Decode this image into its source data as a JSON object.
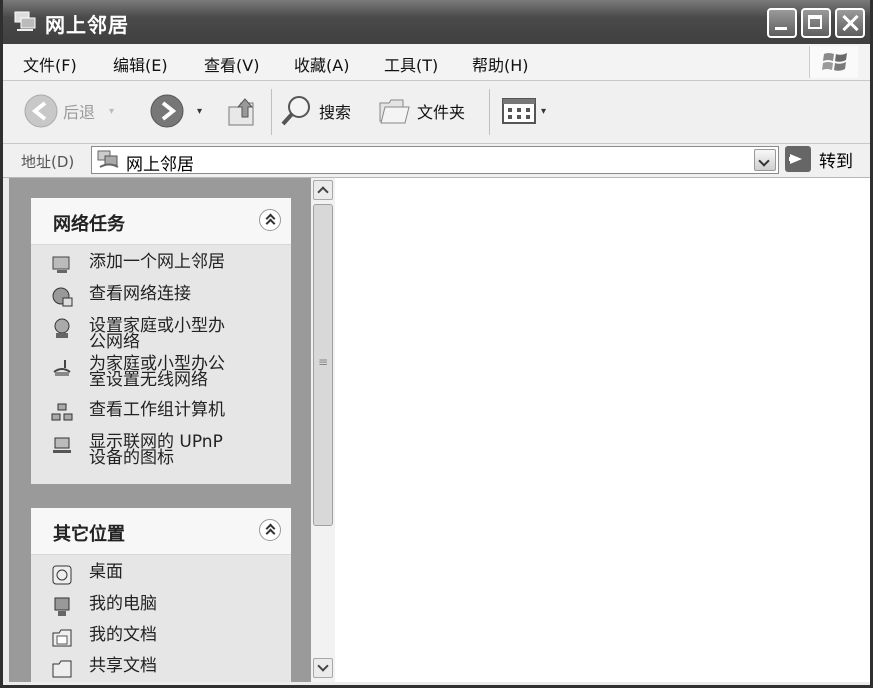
{
  "window": {
    "title": "网上邻居"
  },
  "menu": {
    "items": [
      "文件(F)",
      "编辑(E)",
      "查看(V)",
      "收藏(A)",
      "工具(T)",
      "帮助(H)"
    ]
  },
  "toolbar": {
    "back_label": "后退",
    "search_label": "搜索",
    "folders_label": "文件夹"
  },
  "address": {
    "label": "地址(D)",
    "value": "网上邻居",
    "go_label": "转到"
  },
  "network_tasks": {
    "title": "网络任务",
    "items": [
      {
        "label": "添加一个网上邻居",
        "icon": "add-network-place-icon"
      },
      {
        "label": "查看网络连接",
        "icon": "network-connections-icon"
      },
      {
        "label": "设置家庭或小型办公网络",
        "icon": "network-setup-icon"
      },
      {
        "label": "为家庭或小型办公室设置无线网络",
        "icon": "wireless-network-icon"
      },
      {
        "label": "查看工作组计算机",
        "icon": "workgroup-computers-icon"
      },
      {
        "label": "显示联网的 UPnP 设备的图标",
        "icon": "upnp-devices-icon"
      }
    ]
  },
  "other_places": {
    "title": "其它位置",
    "items": [
      {
        "label": "桌面",
        "icon": "desktop-icon"
      },
      {
        "label": "我的电脑",
        "icon": "my-computer-icon"
      },
      {
        "label": "我的文档",
        "icon": "my-documents-icon"
      },
      {
        "label": "共享文档",
        "icon": "shared-documents-icon"
      }
    ]
  }
}
